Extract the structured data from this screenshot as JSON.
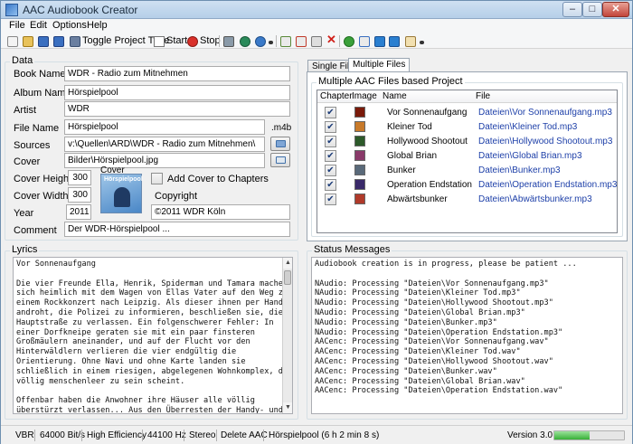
{
  "window": {
    "title": "AAC Audiobook Creator"
  },
  "menu": [
    "File",
    "Edit",
    "Options",
    "Help"
  ],
  "toolbar": {
    "toggle_label": "Toggle Project Type",
    "start_label": "Start",
    "stop_label": "Stop"
  },
  "data_panel": {
    "title": "Data",
    "labels": {
      "book_name": "Book Name",
      "album_name": "Album Name",
      "artist": "Artist",
      "file_name": "File Name",
      "sources": "Sources",
      "cover": "Cover",
      "cover_height": "Cover Height",
      "cover_width": "Cover Width",
      "year": "Year",
      "comment": "Comment",
      "cover_preview": "Cover",
      "copyright": "Copyright",
      "add_cover": "Add Cover to Chapters",
      "ext": ".m4b"
    },
    "values": {
      "book_name": "WDR - Radio zum Mitnehmen",
      "album_name": "Hörspielpool",
      "artist": "WDR",
      "file_name": "Hörspielpool",
      "sources": "v:\\Quellen\\ARD\\WDR - Radio zum Mitnehmen\\",
      "cover": "Bilder\\Hörspielpool.jpg",
      "cover_height": "300",
      "cover_width": "300",
      "year": "2011",
      "copyright": "©2011 WDR Köln",
      "comment": "Der WDR-Hörspielpool ...",
      "cover_art_text": "Hörspielpool"
    }
  },
  "tabs": {
    "single": "Single File",
    "multiple": "Multiple Files"
  },
  "multi_group": {
    "title": "Multiple AAC Files based Project",
    "headers": {
      "chapter": "Chapter",
      "image": "Image",
      "name": "Name",
      "file": "File"
    },
    "rows": [
      {
        "name": "Vor Sonnenaufgang",
        "file": "Dateien\\Vor Sonnenaufgang.mp3",
        "thumb_color": "#7a1a0a"
      },
      {
        "name": "Kleiner Tod",
        "file": "Dateien\\Kleiner Tod.mp3",
        "thumb_color": "#c87a2a"
      },
      {
        "name": "Hollywood Shootout",
        "file": "Dateien\\Hollywood Shootout.mp3",
        "thumb_color": "#2d5a2a"
      },
      {
        "name": "Global Brian",
        "file": "Dateien\\Global Brian.mp3",
        "thumb_color": "#8a3a6a"
      },
      {
        "name": "Bunker",
        "file": "Dateien\\Bunker.mp3",
        "thumb_color": "#5a6a7a"
      },
      {
        "name": "Operation Endstation",
        "file": "Dateien\\Operation Endstation.mp3",
        "thumb_color": "#3a2a6a"
      },
      {
        "name": "Abwärtsbunker",
        "file": "Dateien\\Abwärtsbunker.mp3",
        "thumb_color": "#b03a2a"
      }
    ]
  },
  "lyrics": {
    "title": "Lyrics",
    "text": "Vor Sonnenaufgang\n\nDie vier Freunde Ella, Henrik, Spiderman und Tamara machen\nsich heimlich mit dem Wagen von Ellas Vater auf den Weg zu\neinem Rockkonzert nach Leipzig. Als dieser ihnen per Handy\nandroht, die Polizei zu informieren, beschließen sie, die\nHauptstraße zu verlassen. Ein folgenschwerer Fehler: In\neiner Dorfkneipe geraten sie mit ein paar finsteren\nGroßmäulern aneinander, und auf der Flucht vor den\nHinterwäldlern verlieren die vier endgültig die\nOrientierung. Ohne Navi und ohne Karte landen sie\nschließlich in einem riesigen, abgelegenen Wohnkomplex, der\nvöllig menschenleer zu sein scheint.\n\nOffenbar haben die Anwohner ihre Häuser alle völlig\nüberstürzt verlassen... Aus den Überresten der Handy- und\nDigicam-Aufzeichnungen der vier Freunde wurden die\nEreignisse weitgehend rekonstruiert. Heraus gekommen ist"
  },
  "status": {
    "title": "Status Messages",
    "text": "Audiobook creation is in progress, please be patient ...\n\nNAudio: Processing \"Dateien\\Vor Sonnenaufgang.mp3\"\nNAudio: Processing \"Dateien\\Kleiner Tod.mp3\"\nNAudio: Processing \"Dateien\\Hollywood Shootout.mp3\"\nNAudio: Processing \"Dateien\\Global Brian.mp3\"\nNAudio: Processing \"Dateien\\Bunker.mp3\"\nNAudio: Processing \"Dateien\\Operation Endstation.mp3\"\nAACenc: Processing \"Dateien\\Vor Sonnenaufgang.wav\"\nAACenc: Processing \"Dateien\\Kleiner Tod.wav\"\nAACenc: Processing \"Dateien\\Hollywood Shootout.wav\"\nAACenc: Processing \"Dateien\\Bunker.wav\"\nAACenc: Processing \"Dateien\\Global Brian.wav\"\nAACenc: Processing \"Dateien\\Operation Endstation.wav\""
  },
  "statusbar": {
    "mode": "VBR",
    "bitrate": "64000 Bit/s",
    "profile": "High Efficiency",
    "samplerate": "44100 Hz",
    "channels": "Stereo",
    "delete": "Delete AAC",
    "summary": "Hörspielpool  (6 h 2 min 8 s)",
    "version": "Version 3.0",
    "progress": 0.5
  }
}
